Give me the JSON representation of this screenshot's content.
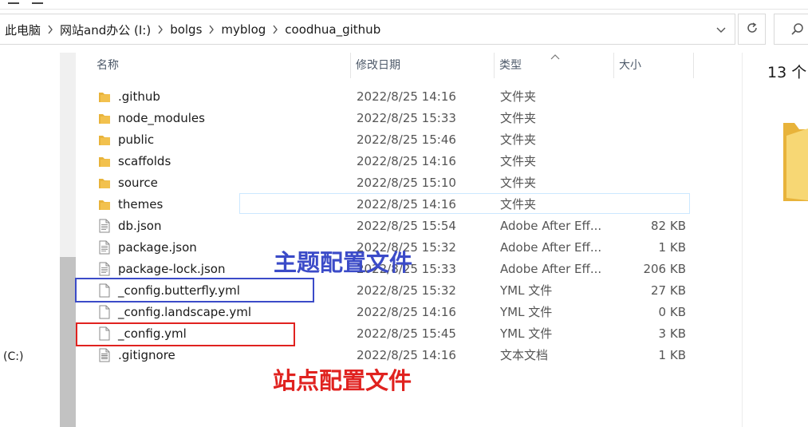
{
  "address": {
    "crumbs": [
      "此电脑",
      "网站and办公 (I:)",
      "bolgs",
      "myblog",
      "coodhua_github"
    ]
  },
  "nav": {
    "drive_c": "(C:)"
  },
  "columns": {
    "name": "名称",
    "date": "修改日期",
    "type": "类型",
    "size": "大小"
  },
  "files": [
    {
      "name": ".github",
      "date": "2022/8/25 14:16",
      "type": "文件夹",
      "size": "",
      "icon": "folder-icon"
    },
    {
      "name": "node_modules",
      "date": "2022/8/25 15:33",
      "type": "文件夹",
      "size": "",
      "icon": "folder-icon"
    },
    {
      "name": "public",
      "date": "2022/8/25 15:46",
      "type": "文件夹",
      "size": "",
      "icon": "folder-icon"
    },
    {
      "name": "scaffolds",
      "date": "2022/8/25 14:16",
      "type": "文件夹",
      "size": "",
      "icon": "folder-icon"
    },
    {
      "name": "source",
      "date": "2022/8/25 15:10",
      "type": "文件夹",
      "size": "",
      "icon": "folder-icon"
    },
    {
      "name": "themes",
      "date": "2022/8/25 14:16",
      "type": "文件夹",
      "size": "",
      "icon": "folder-icon"
    },
    {
      "name": "db.json",
      "date": "2022/8/25 15:54",
      "type": "Adobe After Eff...",
      "size": "82 KB",
      "icon": "json-file-icon"
    },
    {
      "name": "package.json",
      "date": "2022/8/25 15:32",
      "type": "Adobe After Eff...",
      "size": "1 KB",
      "icon": "json-file-icon"
    },
    {
      "name": "package-lock.json",
      "date": "2022/8/25 15:33",
      "type": "Adobe After Eff...",
      "size": "206 KB",
      "icon": "json-file-icon"
    },
    {
      "name": "_config.butterfly.yml",
      "date": "2022/8/25 15:32",
      "type": "YML 文件",
      "size": "27 KB",
      "icon": "file-icon"
    },
    {
      "name": "_config.landscape.yml",
      "date": "2022/8/25 14:16",
      "type": "YML 文件",
      "size": "0 KB",
      "icon": "file-icon"
    },
    {
      "name": "_config.yml",
      "date": "2022/8/25 15:45",
      "type": "YML 文件",
      "size": "3 KB",
      "icon": "file-icon"
    },
    {
      "name": ".gitignore",
      "date": "2022/8/25 14:16",
      "type": "文本文档",
      "size": "1 KB",
      "icon": "text-file-icon"
    }
  ],
  "details": {
    "count": "13 个"
  },
  "annotations": {
    "theme_config_label": "主题配置文件",
    "site_config_label": "站点配置文件"
  },
  "colors": {
    "annotation_blue": "#3b4bc8",
    "annotation_red": "#e0221f",
    "folder": "#f2c14e"
  }
}
